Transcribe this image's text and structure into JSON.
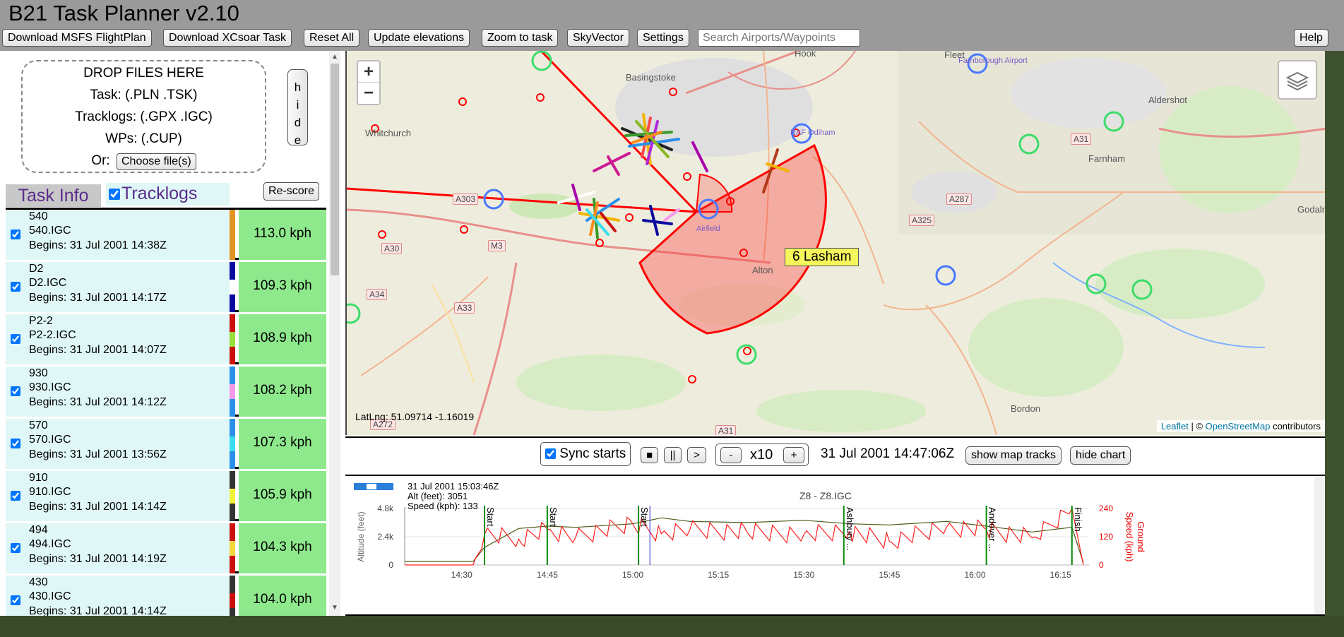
{
  "app": {
    "title": "B21 Task Planner v2.10"
  },
  "toolbar": {
    "download_msfs": "Download MSFS FlightPlan",
    "download_xcsoar": "Download XCsoar Task",
    "reset_all": "Reset All",
    "update_elevations": "Update elevations",
    "zoom_to_task": "Zoom to task",
    "skyvector": "SkyVector",
    "settings": "Settings",
    "search_placeholder": "Search Airports/Waypoints",
    "help": "Help"
  },
  "dropzone": {
    "line1": "DROP FILES HERE",
    "line2": "Task: (.PLN .TSK)",
    "line3": "Tracklogs: (.GPX .IGC)",
    "line4": "WPs: (.CUP)",
    "or_label": "Or:",
    "choose_button": "Choose file(s)",
    "hide_letters": [
      "h",
      "i",
      "d",
      "e"
    ]
  },
  "tabs": {
    "task_info": "Task Info",
    "tracklogs": "Tracklogs",
    "rescore": "Re-score"
  },
  "tracklogs": [
    {
      "name": "540",
      "file": "540.IGC",
      "begins": "Begins: 31 Jul 2001 14:38Z",
      "speed": "113.0 kph",
      "colors": [
        "#e39422",
        "#e39422",
        "#e39422"
      ]
    },
    {
      "name": "D2",
      "file": "D2.IGC",
      "begins": "Begins: 31 Jul 2001 14:17Z",
      "speed": "109.3 kph",
      "colors": [
        "#0a0aa0",
        "#ffffff",
        "#0a0aa0"
      ]
    },
    {
      "name": "P2-2",
      "file": "P2-2.IGC",
      "begins": "Begins: 31 Jul 2001 14:07Z",
      "speed": "108.9 kph",
      "colors": [
        "#cc1010",
        "#9ade3a",
        "#cc1010"
      ]
    },
    {
      "name": "930",
      "file": "930.IGC",
      "begins": "Begins: 31 Jul 2001 14:12Z",
      "speed": "108.2 kph",
      "colors": [
        "#2b8fe8",
        "#f49ae8",
        "#2b8fe8"
      ]
    },
    {
      "name": "570",
      "file": "570.IGC",
      "begins": "Begins: 31 Jul 2001 13:56Z",
      "speed": "107.3 kph",
      "colors": [
        "#2b8fe8",
        "#39dcf0",
        "#2b8fe8"
      ]
    },
    {
      "name": "910",
      "file": "910.IGC",
      "begins": "Begins: 31 Jul 2001 14:14Z",
      "speed": "105.9 kph",
      "colors": [
        "#333333",
        "#f2f23a",
        "#333333"
      ]
    },
    {
      "name": "494",
      "file": "494.IGC",
      "begins": "Begins: 31 Jul 2001 14:19Z",
      "speed": "104.3 kph",
      "colors": [
        "#cc1010",
        "#f2d83a",
        "#cc1010"
      ]
    },
    {
      "name": "430",
      "file": "430.IGC",
      "begins": "Begins: 31 Jul 2001 14:14Z",
      "speed": "104.0 kph",
      "colors": [
        "#333333",
        "#cc1010",
        "#333333"
      ]
    }
  ],
  "map": {
    "zoom_in": "+",
    "zoom_out": "−",
    "latlng": "LatLng: 51.09714 -1.16019",
    "attribution_leaflet": "Leaflet",
    "attribution_sep": " | © ",
    "attribution_osm": "OpenStreetMap",
    "attribution_tail": " contributors",
    "waypoint_tooltip": "6 Lasham",
    "place_labels": [
      "Basingstoke",
      "Whitchurch",
      "Hook",
      "Fleet",
      "Aldershot",
      "Farnham",
      "Alton",
      "Bordon",
      "Godalm",
      "RAF Odiham",
      "Farnborough Airport",
      "Airfield"
    ],
    "road_labels": [
      "A303",
      "A30",
      "M3",
      "A34",
      "A33",
      "A325",
      "A287",
      "A31",
      "A272",
      "A31"
    ]
  },
  "controls": {
    "sync_starts": "Sync starts",
    "stop": "■",
    "pause": "||",
    "play": ">",
    "slower": "-",
    "speed": "x10",
    "faster": "+",
    "time": "31 Jul 2001 14:47:06Z",
    "show_map_tracks": "show map tracks",
    "hide_chart": "hide chart"
  },
  "chart": {
    "info_time": "31 Jul 2001 15:03:46Z",
    "info_alt": "Alt (feet): 3051",
    "info_speed": "Speed (kph): 133",
    "title": "Z8 - Z8.IGC",
    "ylabel_left": "Altitude (feet)",
    "ylabel_right_1": "Ground",
    "ylabel_right_2": "Speed (kph)",
    "y_left_ticks": [
      "4.8k",
      "2.4k",
      "0"
    ],
    "y_right_ticks": [
      "240",
      "120",
      "0"
    ],
    "x_ticks": [
      "14:30",
      "14:45",
      "15:00",
      "15:15",
      "15:30",
      "15:45",
      "16:00",
      "16:15"
    ],
    "markers": [
      "Start",
      "Start",
      "Start",
      "Ashbury ...",
      "Andover ...",
      "Finish"
    ]
  },
  "chart_data": {
    "type": "line",
    "title": "Z8 - Z8.IGC",
    "xlabel": "",
    "ylabel": "Altitude (feet)",
    "y2label": "Ground Speed (kph)",
    "x": [
      "14:20",
      "14:32",
      "14:34",
      "14:40",
      "14:45",
      "14:50",
      "15:00",
      "15:05",
      "15:10",
      "15:20",
      "15:30",
      "15:38",
      "15:45",
      "15:55",
      "16:02",
      "16:10",
      "16:17",
      "16:19"
    ],
    "ylim": [
      0,
      4800
    ],
    "y2lim": [
      0,
      240
    ],
    "series": [
      {
        "name": "",
        "values": [
          300,
          300,
          1500,
          3100,
          3300,
          3200,
          3500,
          4000,
          3700,
          3600,
          3800,
          3500,
          3400,
          3700,
          3300,
          2800,
          3200,
          200
        ]
      },
      {
        "name": "",
        "values": [
          0,
          0,
          130,
          110,
          150,
          120,
          175,
          133,
          150,
          140,
          130,
          140,
          100,
          160,
          150,
          115,
          240,
          0
        ]
      }
    ],
    "markers": [
      {
        "label": "Start",
        "x": "14:34"
      },
      {
        "label": "Start",
        "x": "14:45"
      },
      {
        "label": "Start",
        "x": "15:01"
      },
      {
        "label": "Ashbury ...",
        "x": "15:37"
      },
      {
        "label": "Andover ...",
        "x": "16:02"
      },
      {
        "label": "Finish",
        "x": "16:17"
      }
    ]
  }
}
